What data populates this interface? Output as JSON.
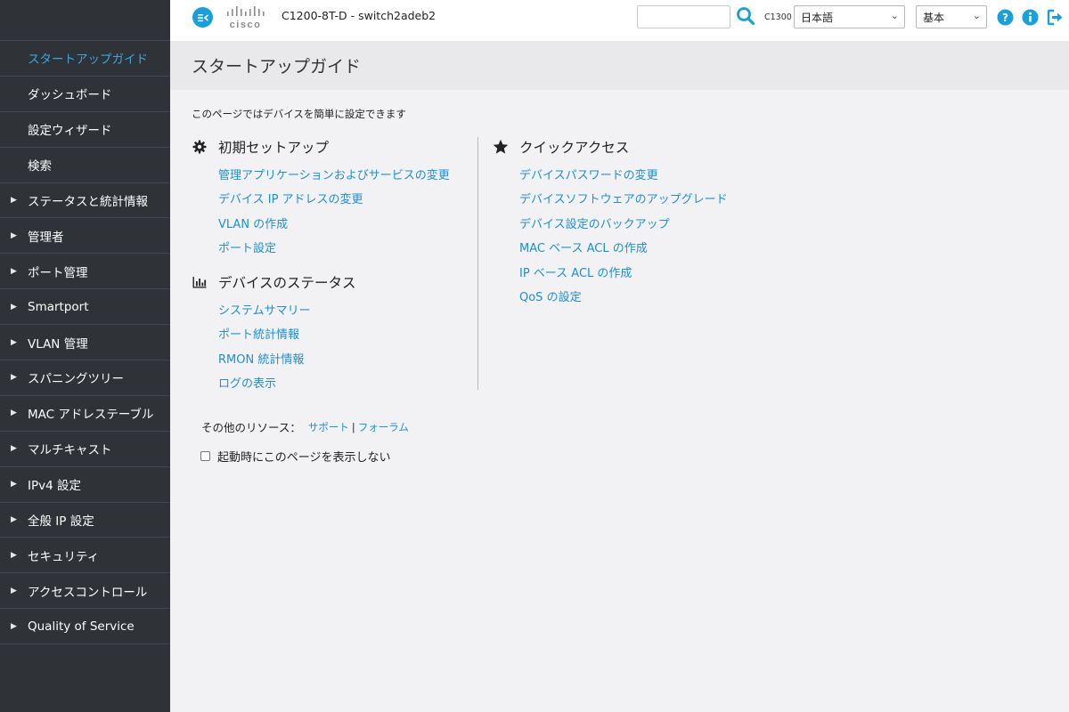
{
  "header": {
    "brand": "cisco",
    "device_title": "C1200-8T-D - switch2adeb2",
    "search_value": "",
    "model": "C1300",
    "language": "日本語",
    "mode": "基本",
    "icons": [
      "menu-toggle-icon",
      "search-icon",
      "help-icon",
      "info-icon",
      "logout-icon"
    ],
    "accent_color": "#1a9fd9"
  },
  "sidebar": {
    "items": [
      {
        "label": "スタートアップガイド",
        "active": true,
        "expandable": false
      },
      {
        "label": "ダッシュボード",
        "active": false,
        "expandable": false
      },
      {
        "label": "設定ウィザード",
        "active": false,
        "expandable": false
      },
      {
        "label": "検索",
        "active": false,
        "expandable": false
      },
      {
        "label": "ステータスと統計情報",
        "active": false,
        "expandable": true
      },
      {
        "label": "管理者",
        "active": false,
        "expandable": true
      },
      {
        "label": "ポート管理",
        "active": false,
        "expandable": true
      },
      {
        "label": "Smartport",
        "active": false,
        "expandable": true
      },
      {
        "label": "VLAN 管理",
        "active": false,
        "expandable": true
      },
      {
        "label": "スパニングツリー",
        "active": false,
        "expandable": true
      },
      {
        "label": "MAC アドレステーブル",
        "active": false,
        "expandable": true
      },
      {
        "label": "マルチキャスト",
        "active": false,
        "expandable": true
      },
      {
        "label": "IPv4 設定",
        "active": false,
        "expandable": true
      },
      {
        "label": "全般 IP 設定",
        "active": false,
        "expandable": true
      },
      {
        "label": "セキュリティ",
        "active": false,
        "expandable": true
      },
      {
        "label": "アクセスコントロール",
        "active": false,
        "expandable": true
      },
      {
        "label": "Quality of Service",
        "active": false,
        "expandable": true
      }
    ]
  },
  "main": {
    "title": "スタートアップガイド",
    "intro": "このページではデバイスを簡単に設定できます",
    "initial_setup": {
      "heading": "初期セットアップ",
      "links": [
        "管理アプリケーションおよびサービスの変更",
        "デバイス IP アドレスの変更",
        "VLAN の作成",
        "ポート設定"
      ]
    },
    "device_status": {
      "heading": "デバイスのステータス",
      "links": [
        "システムサマリー",
        "ポート統計情報",
        "RMON 統計情報",
        "ログの表示"
      ]
    },
    "quick_access": {
      "heading": "クイックアクセス",
      "links": [
        "デバイスパスワードの変更",
        "デバイスソフトウェアのアップグレード",
        "デバイス設定のバックアップ",
        "MAC ベース ACL の作成",
        "IP ベース ACL の作成",
        "QoS の設定"
      ]
    },
    "resources": {
      "label": "その他のリソース：",
      "support": "サポート",
      "separator": "|",
      "forum": "フォーラム"
    },
    "startup_checkbox": {
      "label": "起動時にこのページを表示しない",
      "checked": false
    },
    "link_color": "#1f8fd1"
  }
}
